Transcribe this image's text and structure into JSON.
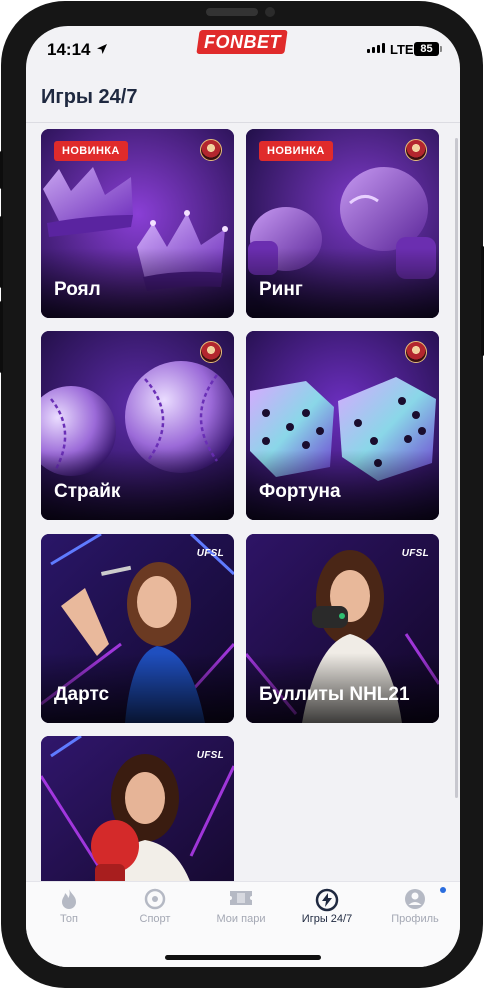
{
  "status_bar": {
    "time": "14:14",
    "network": "LTE",
    "battery": "85"
  },
  "brand": {
    "name": "FONBET",
    "color": "#e02b2b"
  },
  "header": {
    "title": "Игры 24/7"
  },
  "games": [
    {
      "title": "Роял",
      "badge": "НОВИНКА",
      "logo": "hardball-logo",
      "art": "crowns"
    },
    {
      "title": "Ринг",
      "badge": "НОВИНКА",
      "logo": "hardball-logo",
      "art": "boxing-gloves"
    },
    {
      "title": "Страйк",
      "badge": "",
      "logo": "hardball-logo",
      "art": "baseballs"
    },
    {
      "title": "Фортуна",
      "badge": "",
      "logo": "hardball-logo",
      "art": "dice"
    },
    {
      "title": "Дартс",
      "badge": "",
      "logo": "UFSL",
      "art": "woman-darts"
    },
    {
      "title": "Буллиты NHL21",
      "badge": "",
      "logo": "UFSL",
      "art": "woman-gamepad"
    },
    {
      "title": "",
      "badge": "",
      "logo": "UFSL",
      "art": "woman-boxing-glove"
    }
  ],
  "tabbar": {
    "items": [
      {
        "label": "Топ",
        "icon": "flame-icon",
        "active": false
      },
      {
        "label": "Спорт",
        "icon": "target-icon",
        "active": false
      },
      {
        "label": "Мои пари",
        "icon": "ticket-icon",
        "active": false
      },
      {
        "label": "Игры 24/7",
        "icon": "bolt-circle-icon",
        "active": true
      },
      {
        "label": "Профиль",
        "icon": "user-circle-icon",
        "active": false
      }
    ],
    "notification_color": "#2a6dde"
  },
  "colors": {
    "accent": "#e02b2b",
    "title_text": "#1f2940",
    "inactive_tab": "#a4a8b4"
  }
}
